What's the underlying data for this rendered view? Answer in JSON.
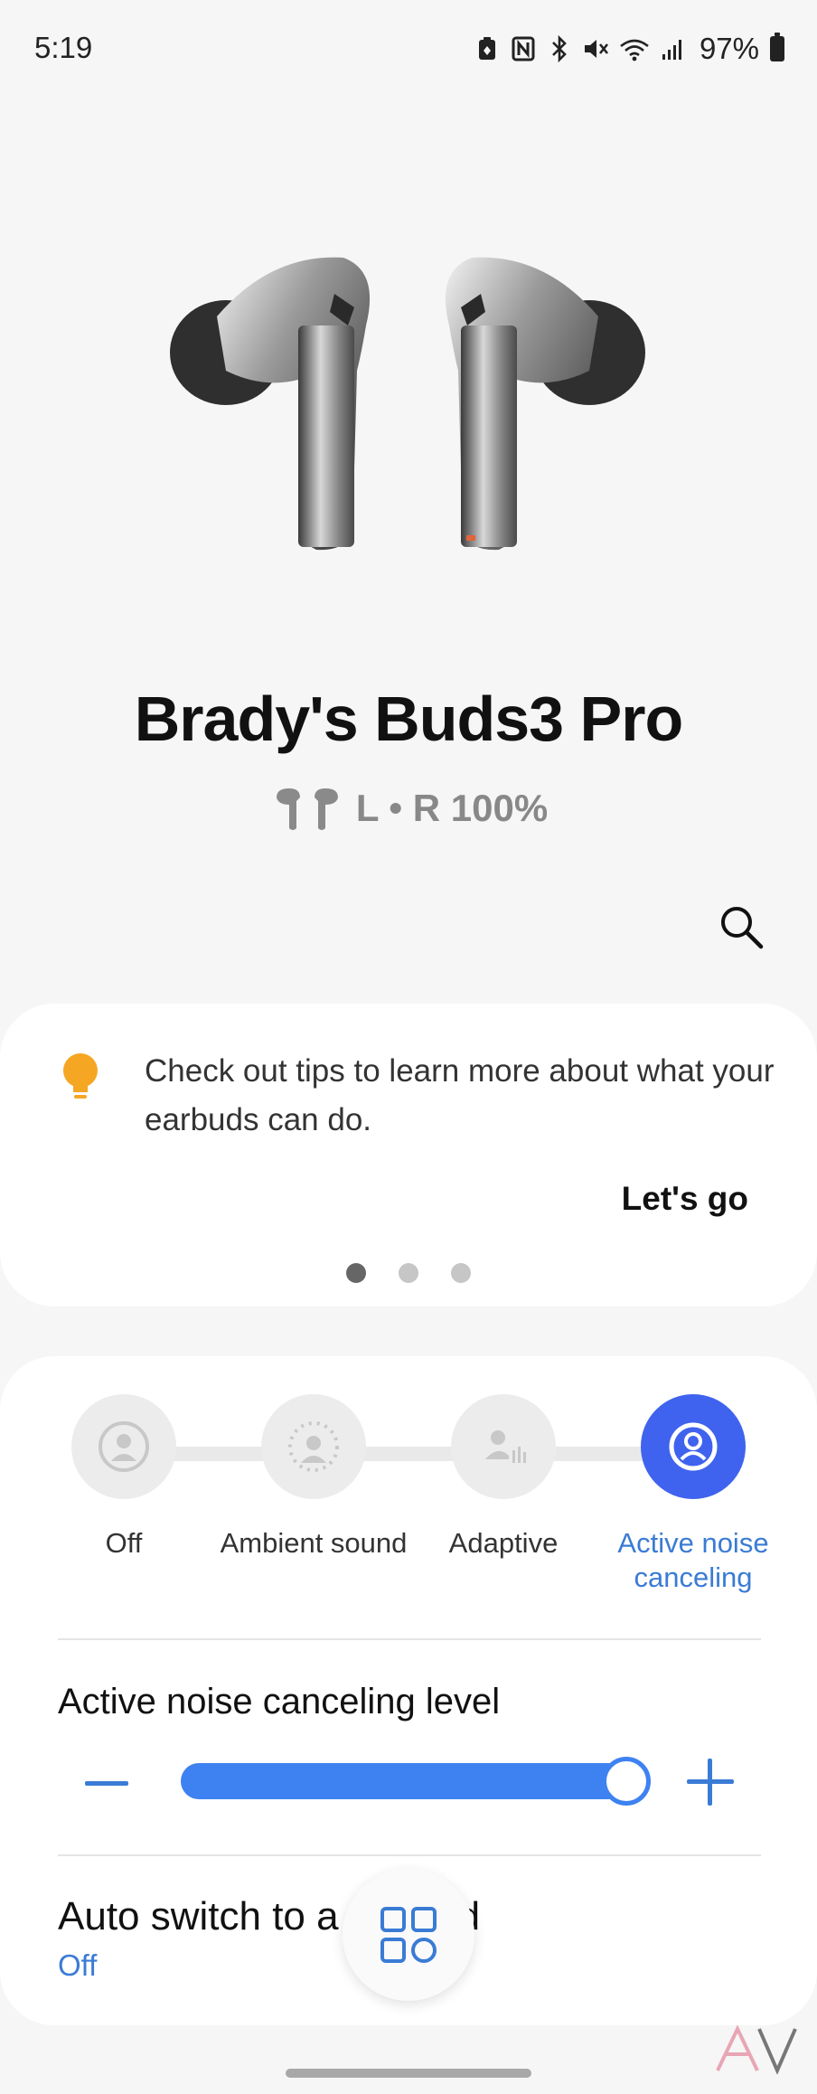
{
  "status_bar": {
    "time": "5:19",
    "battery_percent": "97%",
    "icons": [
      "battery-saver-icon",
      "nfc-icon",
      "bluetooth-icon",
      "mute-icon",
      "wifi-icon",
      "signal-icon",
      "battery-icon"
    ]
  },
  "device": {
    "name": "Brady's Buds3 Pro",
    "battery_text": "L • R 100%"
  },
  "tips": {
    "text": "Check out tips to learn more about what your earbuds can do.",
    "action_label": "Let's go",
    "page_count": 3,
    "active_page": 1
  },
  "noise_modes": {
    "modes": [
      {
        "label": "Off",
        "selected": false
      },
      {
        "label": "Ambient sound",
        "selected": false
      },
      {
        "label": "Adaptive",
        "selected": false
      },
      {
        "label": "Active noise canceling",
        "selected": true
      }
    ]
  },
  "anc_level": {
    "title": "Active noise canceling level",
    "value": 1.0
  },
  "auto_switch": {
    "title": "Auto switch to a    t sound",
    "value": "Off"
  },
  "colors": {
    "accent": "#3a7bd5",
    "selected_mode": "#3f63ee",
    "slider": "#3e82f2",
    "tip_bulb": "#f5a623"
  }
}
